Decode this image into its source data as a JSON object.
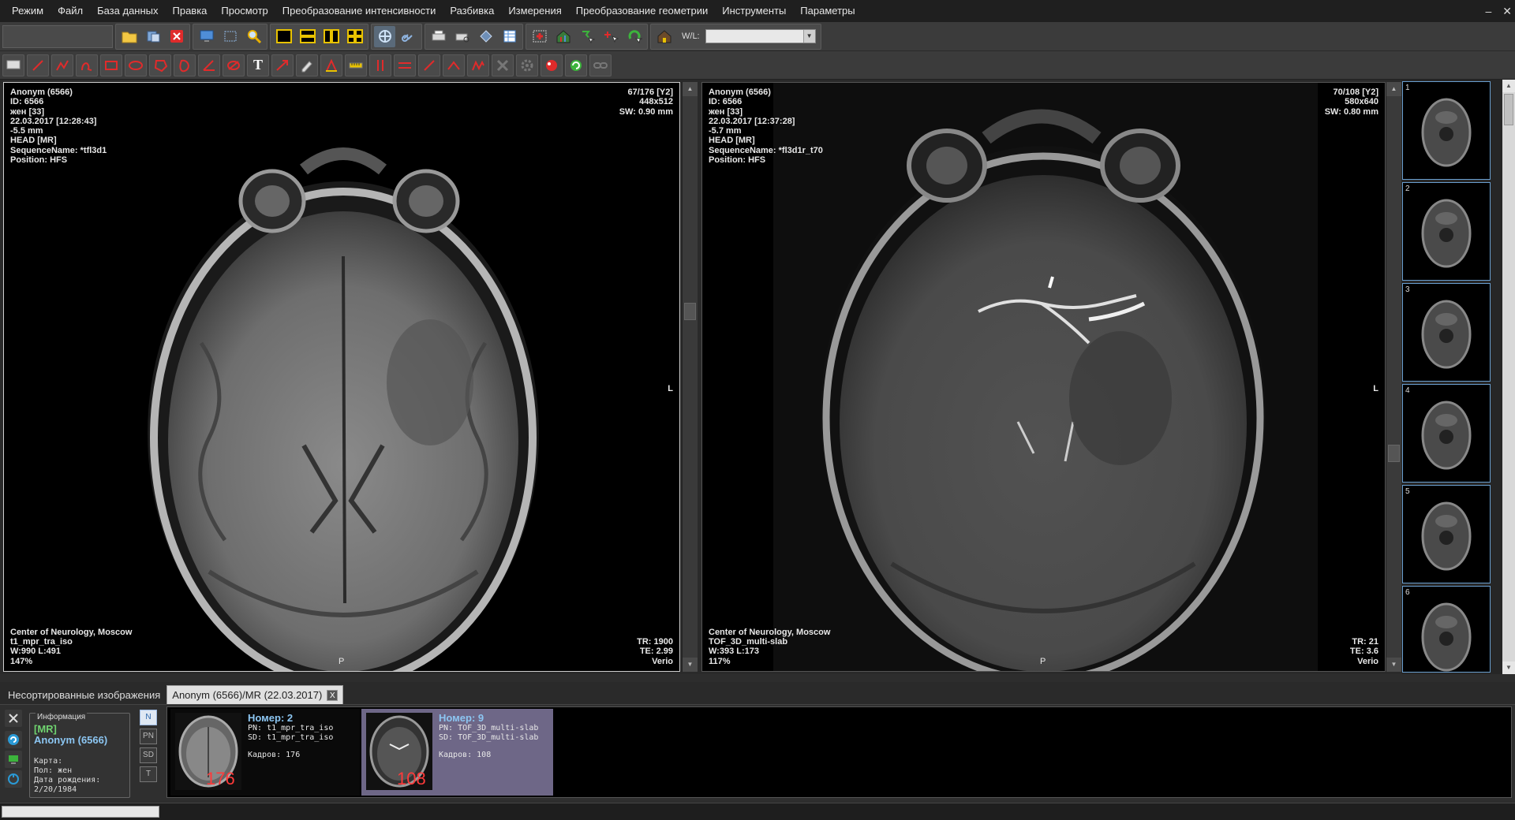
{
  "menu": [
    "Режим",
    "Файл",
    "База данных",
    "Правка",
    "Просмотр",
    "Преобразование интенсивности",
    "Разбивка",
    "Измерения",
    "Преобразование геометрии",
    "Инструменты",
    "Параметры"
  ],
  "window_controls": {
    "minimize": "–",
    "close": "✕"
  },
  "toolbar": {
    "wl_label": "W/L:",
    "wl_value": ""
  },
  "viewport1": {
    "top_left": [
      "Anonym (6566)",
      "ID: 6566",
      "жен [33]",
      "22.03.2017 [12:28:43]",
      "-5.5 mm",
      "HEAD [MR]",
      "SequenceName: *tfl3d1",
      "Position: HFS"
    ],
    "top_right": [
      "67/176 [Y2]",
      "448x512",
      "SW: 0.90 mm"
    ],
    "bottom_left": [
      "Center of Neurology, Moscow",
      "t1_mpr_tra_iso",
      "W:990 L:491",
      "147%"
    ],
    "bottom_right": [
      "TR: 1900",
      "TE: 2.99",
      "Verio"
    ],
    "orient_right": "L",
    "orient_bottom": "P"
  },
  "viewport2": {
    "top_left": [
      "Anonym (6566)",
      "ID: 6566",
      "жен [33]",
      "22.03.2017 [12:37:28]",
      "-5.7 mm",
      "HEAD [MR]",
      "SequenceName: *fl3d1r_t70",
      "Position: HFS"
    ],
    "top_right": [
      "70/108 [Y2]",
      "580x640",
      "SW: 0.80 mm"
    ],
    "bottom_left": [
      "Center of Neurology, Moscow",
      "TOF_3D_multi-slab",
      "W:393 L:173",
      "117%"
    ],
    "bottom_right": [
      "TR: 21",
      "TE: 3.6",
      "Verio"
    ],
    "orient_right": "L",
    "orient_bottom": "P"
  },
  "thumbnails": [
    "1",
    "2",
    "3",
    "4",
    "5",
    "6"
  ],
  "tabs": {
    "unsorted": "Несортированные изображения",
    "study": "Anonym (6566)/MR (22.03.2017)",
    "close": "X"
  },
  "info": {
    "legend": "Информация",
    "modality": "[MR]",
    "patient": "Anonym (6566)",
    "card": "Карта:",
    "sex": "Пол: жен",
    "dob_label": "Дата рождения:",
    "dob": "2/20/1984"
  },
  "filter_buttons": [
    "N",
    "PN",
    "SD",
    "T"
  ],
  "series": [
    {
      "title": "Номер: 2",
      "pn": "PN:   t1_mpr_tra_iso",
      "sd": "SD:   t1_mpr_tra_iso",
      "frames": "Кадров: 176",
      "count": "176"
    },
    {
      "title": "Номер: 9",
      "pn": "PN:   TOF_3D_multi-slab",
      "sd": "SD:   TOF_3D_multi-slab",
      "frames": "Кадров: 108",
      "count": "108"
    }
  ],
  "colors": {
    "accent": "#8cc6f2",
    "modality": "#6fd36f",
    "count": "#ff3a3a",
    "selected_series": "#6e6787"
  }
}
